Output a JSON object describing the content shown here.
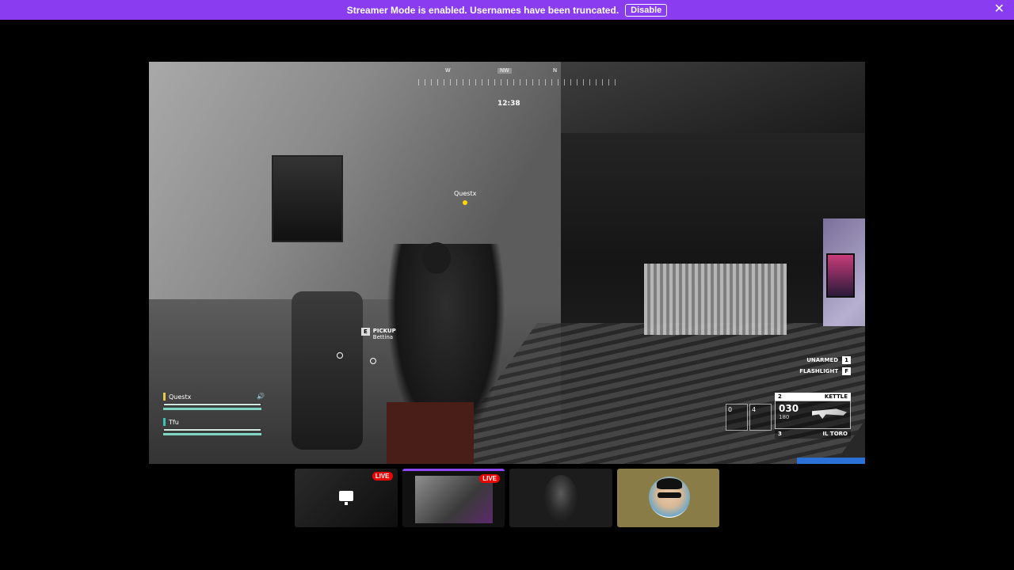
{
  "banner": {
    "message": "Streamer Mode is enabled. Usernames have been truncated.",
    "disable_label": "Disable",
    "close_glyph": "✕",
    "color": "#8a3cf0"
  },
  "hud": {
    "compass": [
      "W",
      "NW",
      "N"
    ],
    "timer": "12:38",
    "marker_name": "Questx",
    "pickup_key": "E",
    "pickup_action": "PICKUP",
    "pickup_target": "Bettina",
    "team": [
      {
        "name": "Questx",
        "flag_color": "#e8c84a"
      },
      {
        "name": "Tfu",
        "flag_color": "#3cc4b4"
      }
    ],
    "speaker_glyph": "🔊",
    "binds": [
      {
        "label": "UNARMED",
        "key": "1"
      },
      {
        "label": "FLASHLIGHT",
        "key": "F"
      }
    ],
    "ammo_slots": [
      "0",
      "4"
    ],
    "weapon": {
      "slot": "2",
      "name": "KETTLE",
      "ammo": "030",
      "reserve": "180",
      "alt_slot": "3",
      "alt_name": "IL TORO"
    }
  },
  "thumbnails": [
    {
      "live": "LIVE",
      "icon": "screen-share-icon"
    },
    {
      "live": "LIVE",
      "icon": "game-preview"
    },
    {
      "live": "",
      "icon": "hooded-avatar"
    },
    {
      "live": "",
      "icon": "sunglasses-avatar"
    }
  ],
  "colors": {
    "accent": "#9147ff",
    "live": "#eb0400"
  }
}
